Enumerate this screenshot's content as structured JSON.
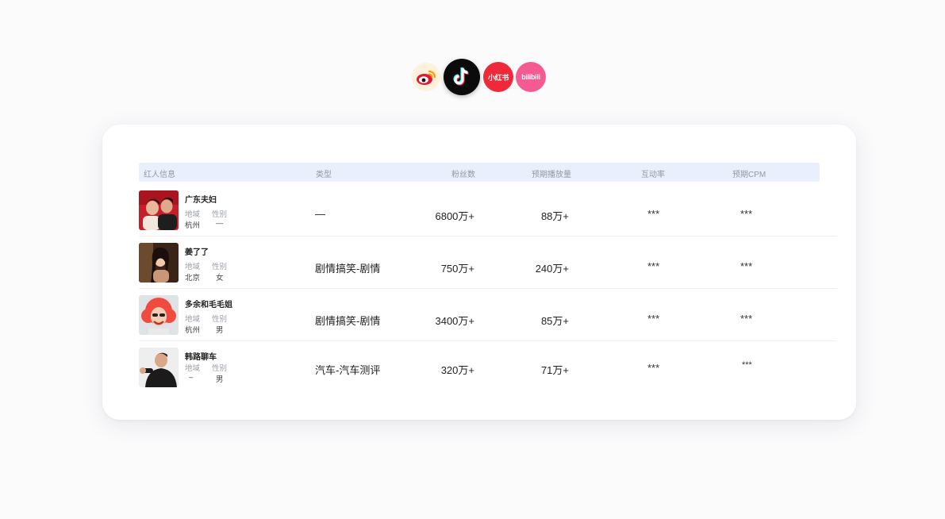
{
  "platforms": [
    {
      "name": "weibo",
      "icon": "weibo-icon",
      "color": "#fff1dc"
    },
    {
      "name": "douyin",
      "icon": "douyin-icon",
      "color": "#0b0b0b"
    },
    {
      "name": "xiaohongshu",
      "icon": "xiaohongshu-icon",
      "label": "小红书",
      "color": "#ee2a3a"
    },
    {
      "name": "bilibili",
      "icon": "bilibili-icon",
      "label": "bilibili",
      "color": "#f55a93"
    }
  ],
  "table": {
    "headers": {
      "info": "红人信息",
      "type": "类型",
      "fans": "粉丝数",
      "plays": "预期播放量",
      "engagement": "互动率",
      "cpm": "预期CPM"
    },
    "region_label": "地域",
    "gender_label": "性别",
    "rows": [
      {
        "name": "广东夫妇",
        "region": "杭州",
        "gender": "—",
        "type": "—",
        "fans": "6800万+",
        "plays": "88万+",
        "engagement": "***",
        "cpm": "***"
      },
      {
        "name": "姜了了",
        "region": "北京",
        "gender": "女",
        "type": "剧情搞笑-剧情",
        "fans": "750万+",
        "plays": "240万+",
        "engagement": "***",
        "cpm": "***"
      },
      {
        "name": "多余和毛毛姐",
        "region": "杭州",
        "gender": "男",
        "type": "剧情搞笑-剧情",
        "fans": "3400万+",
        "plays": "85万+",
        "engagement": "***",
        "cpm": "***"
      },
      {
        "name": "韩路聊车",
        "region": "–",
        "gender": "男",
        "type": "汽车-汽车测评",
        "fans": "320万+",
        "plays": "71万+",
        "engagement": "***",
        "cpm": "***"
      }
    ]
  }
}
